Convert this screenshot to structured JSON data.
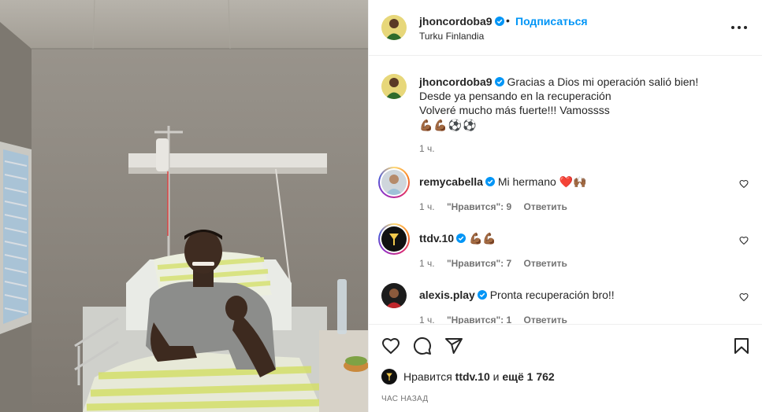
{
  "post": {
    "username": "jhoncordoba9",
    "follow_label": "Подписаться",
    "separator": "•",
    "location": "Turku Finlandia",
    "more_label": "Дополнительно"
  },
  "caption": {
    "username": "jhoncordoba9",
    "lines": [
      "Gracias a Dios mi operación salió bien!",
      "Desde ya pensando en la recuperación",
      "Volveré mucho más fuerte!!! Vamossss"
    ],
    "emojis": "💪🏾💪🏾⚽⚽",
    "time": "1 ч."
  },
  "comments": [
    {
      "username": "remycabella",
      "text": "Mi hermano ❤️🙌🏾",
      "time": "1 ч.",
      "likes": "\"Нравится\": 9",
      "reply": "Ответить"
    },
    {
      "username": "ttdv.10",
      "text": "💪🏾💪🏾",
      "time": "1 ч.",
      "likes": "\"Нравится\": 7",
      "reply": "Ответить"
    },
    {
      "username": "alexis.play",
      "text": "Pronta recuperación bro!!",
      "time": "1 ч.",
      "likes": "\"Нравится\": 1",
      "reply": "Ответить"
    }
  ],
  "likes": {
    "prefix": "Нравится",
    "user": "ttdv.10",
    "connector": "и",
    "others": "ещё 1 762"
  },
  "posted_time": "час назад",
  "colors": {
    "link": "#0095f6",
    "muted": "#737373",
    "verified": "#0095f6",
    "text": "#262626"
  },
  "icons": [
    "heart-icon",
    "comment-icon",
    "share-icon",
    "bookmark-icon",
    "verified-icon",
    "more-icon"
  ]
}
